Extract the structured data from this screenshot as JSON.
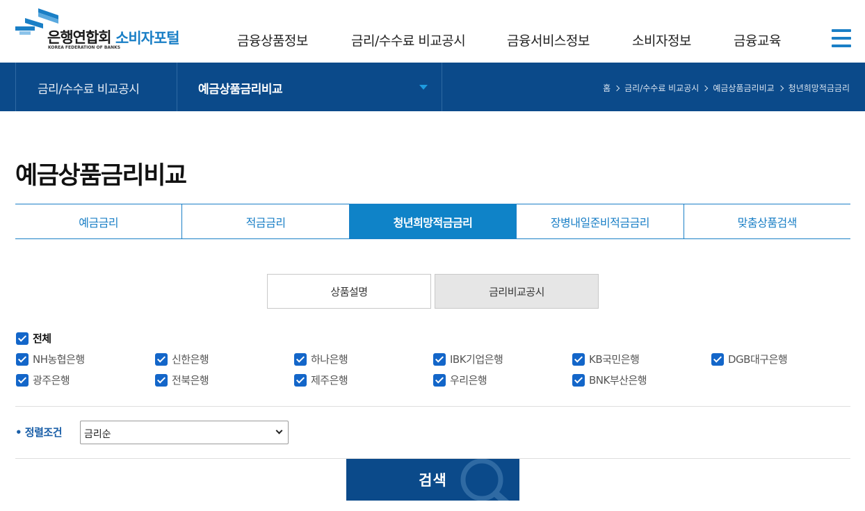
{
  "header": {
    "logo_title": "은행연합회",
    "logo_sub": "KOREA FEDERATION OF BANKS",
    "logo_portal": "소비자포털",
    "nav": [
      "금융상품정보",
      "금리/수수료 비교공시",
      "금융서비스정보",
      "소비자정보",
      "금융교육"
    ]
  },
  "subnav": {
    "category": "금리/수수료 비교공시",
    "current": "예금상품금리비교",
    "breadcrumb": [
      "홈",
      "금리/수수료 비교공시",
      "예금상품금리비교",
      "청년희망적금금리"
    ]
  },
  "page_title": "예금상품금리비교",
  "tabs": [
    {
      "label": "예금금리",
      "active": false
    },
    {
      "label": "적금금리",
      "active": false
    },
    {
      "label": "청년희망적금금리",
      "active": true
    },
    {
      "label": "장병내일준비적금금리",
      "active": false
    },
    {
      "label": "맞춤상품검색",
      "active": false
    }
  ],
  "subtabs": [
    {
      "label": "상품설명",
      "active": false
    },
    {
      "label": "금리비교공시",
      "active": true
    }
  ],
  "filters": {
    "all_label": "전체",
    "banks": [
      "NH농협은행",
      "신한은행",
      "하나은행",
      "IBK기업은행",
      "KB국민은행",
      "DGB대구은행",
      "광주은행",
      "전북은행",
      "제주은행",
      "우리은행",
      "BNK부산은행"
    ]
  },
  "sort": {
    "label": "• 정렬조건",
    "value": "금리순"
  },
  "search_button": "검색",
  "colors": {
    "navy": "#0b4a8a",
    "blue": "#1a7fc6",
    "active_tab": "#0f83c8",
    "checkbox": "#1366c9"
  }
}
